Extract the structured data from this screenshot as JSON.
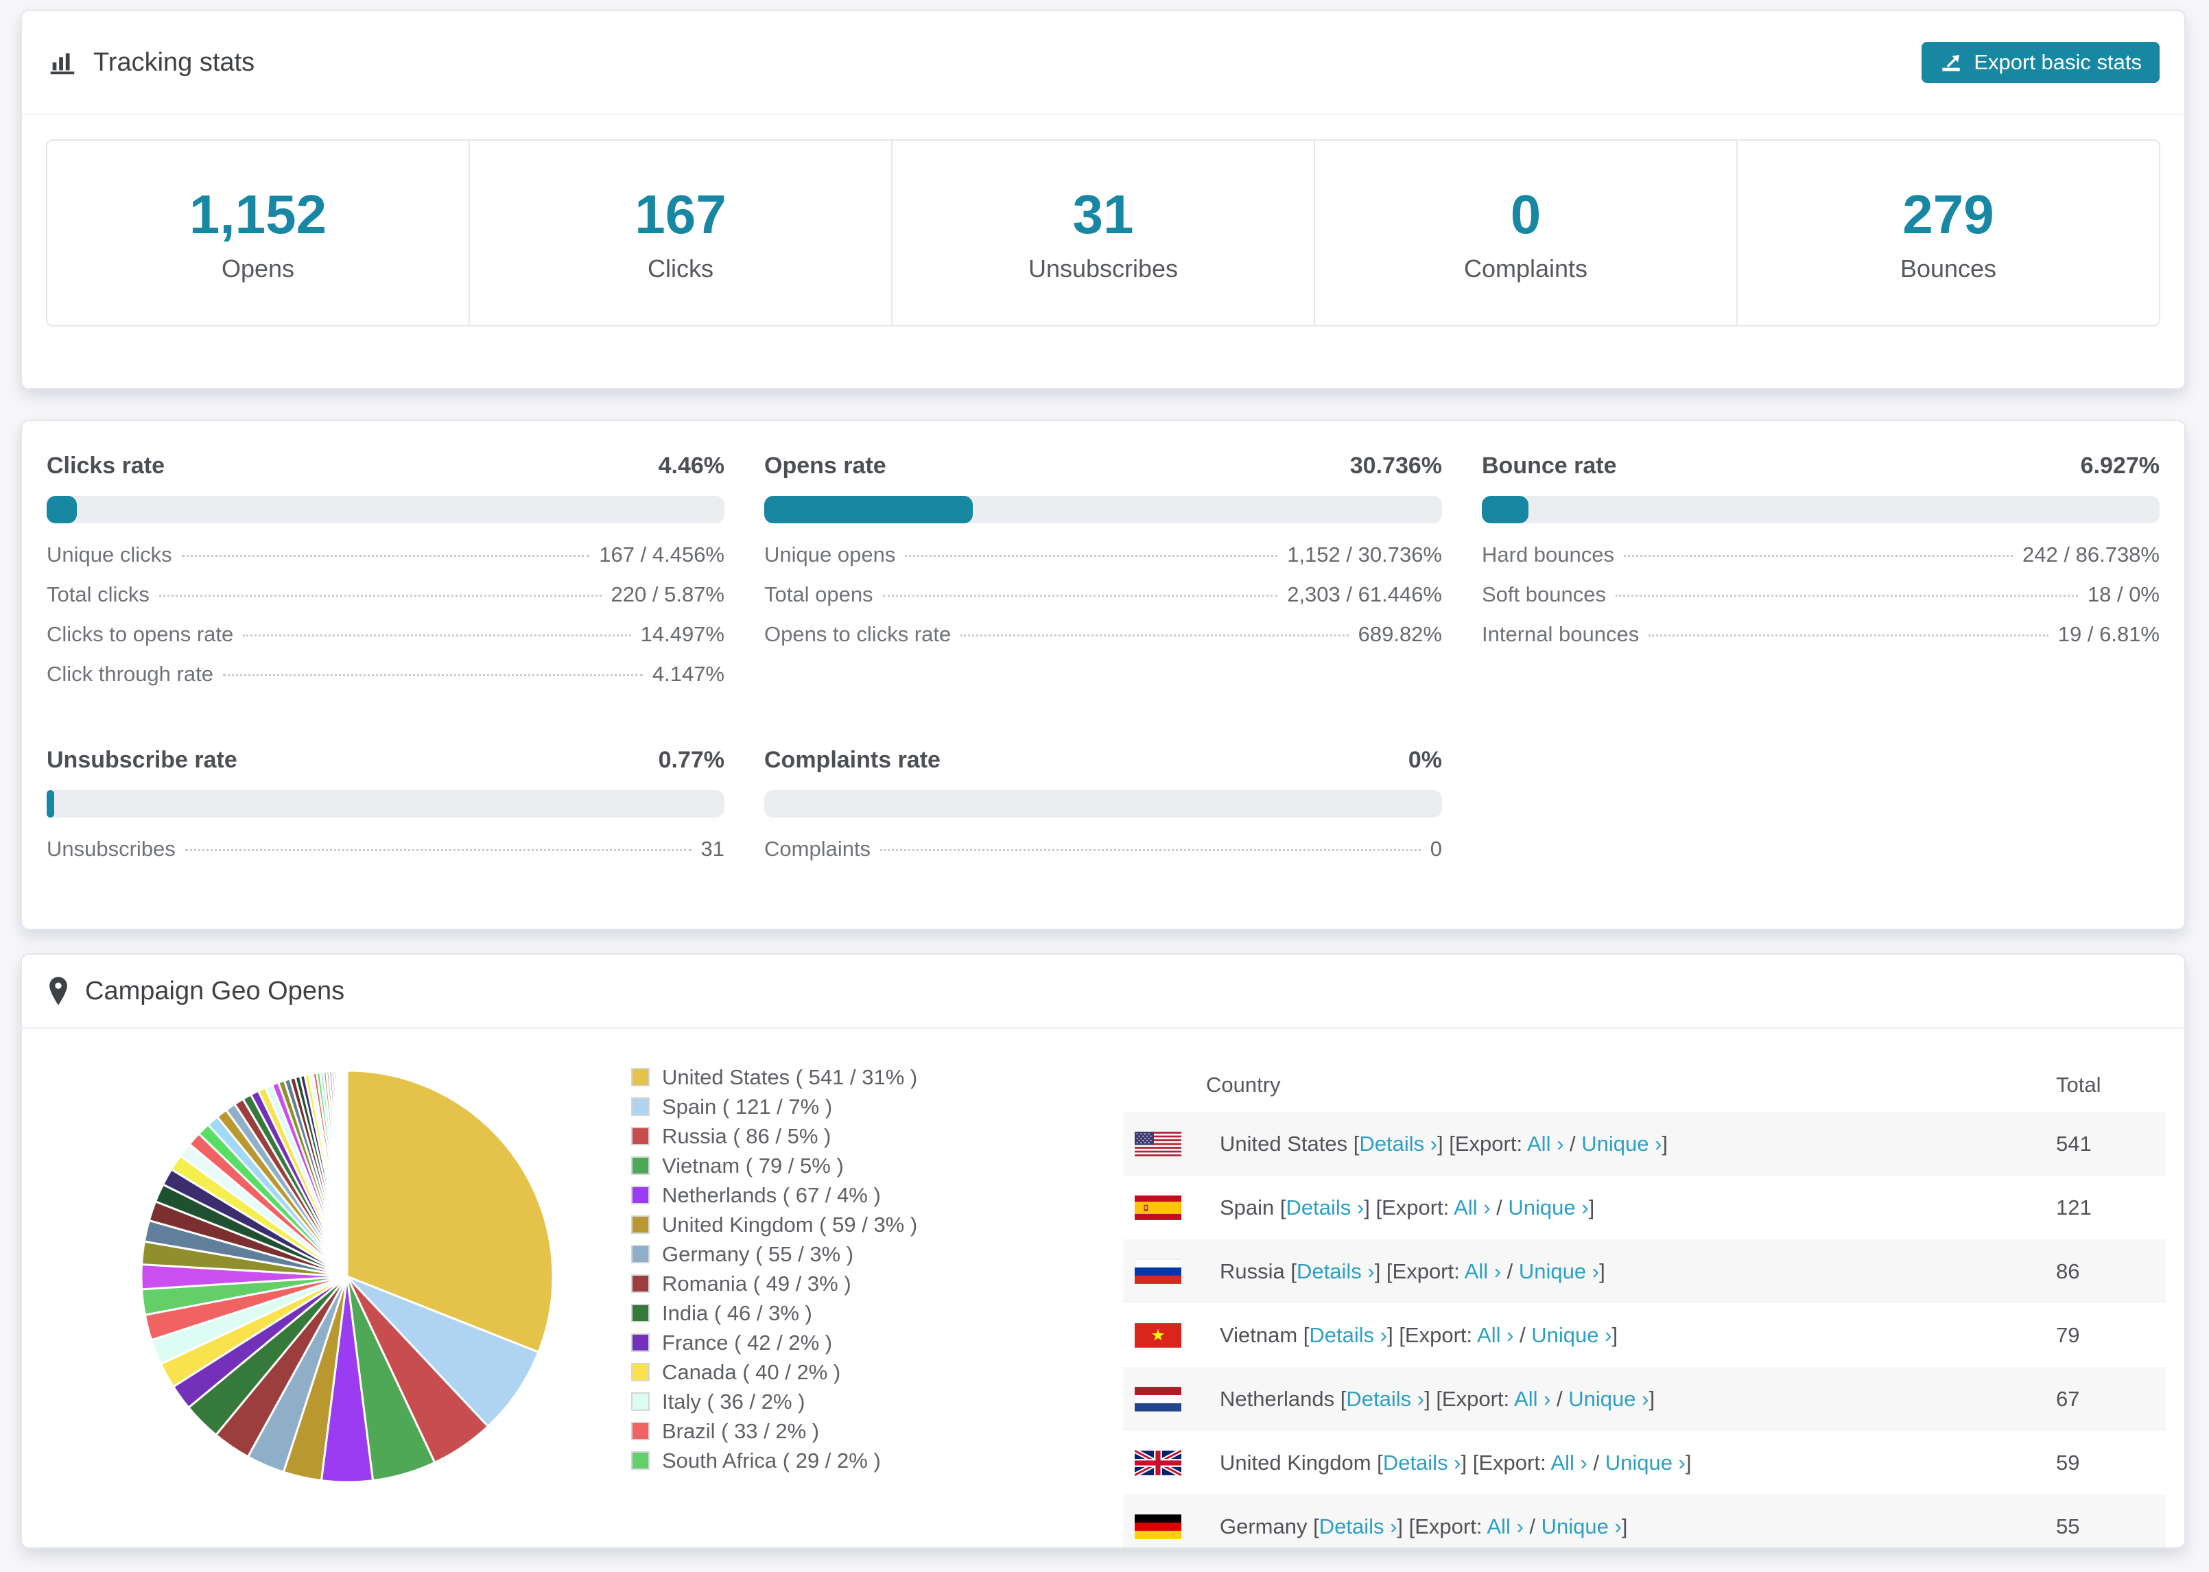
{
  "accent_color": "#1787a2",
  "link_color": "#2d9fc2",
  "tracking": {
    "title": "Tracking stats",
    "export_button": "Export basic stats",
    "stats": [
      {
        "value": "1,152",
        "label": "Opens"
      },
      {
        "value": "167",
        "label": "Clicks"
      },
      {
        "value": "31",
        "label": "Unsubscribes"
      },
      {
        "value": "0",
        "label": "Complaints"
      },
      {
        "value": "279",
        "label": "Bounces"
      }
    ]
  },
  "rates": [
    {
      "title": "Clicks rate",
      "value": "4.46%",
      "percent": 4.46,
      "rows": [
        {
          "label": "Unique clicks",
          "value": "167 / 4.456%"
        },
        {
          "label": "Total clicks",
          "value": "220 / 5.87%"
        },
        {
          "label": "Clicks to opens rate",
          "value": "14.497%"
        },
        {
          "label": "Click through rate",
          "value": "4.147%"
        }
      ]
    },
    {
      "title": "Opens rate",
      "value": "30.736%",
      "percent": 30.736,
      "rows": [
        {
          "label": "Unique opens",
          "value": "1,152 / 30.736%"
        },
        {
          "label": "Total opens",
          "value": "2,303 / 61.446%"
        },
        {
          "label": "Opens to clicks rate",
          "value": "689.82%"
        }
      ]
    },
    {
      "title": "Bounce rate",
      "value": "6.927%",
      "percent": 6.927,
      "rows": [
        {
          "label": "Hard bounces",
          "value": "242 / 86.738%"
        },
        {
          "label": "Soft bounces",
          "value": "18 / 0%"
        },
        {
          "label": "Internal bounces",
          "value": "19 / 6.81%"
        }
      ]
    },
    {
      "title": "Unsubscribe rate",
      "value": "0.77%",
      "percent": 0.77,
      "rows": [
        {
          "label": "Unsubscribes",
          "value": "31"
        }
      ]
    },
    {
      "title": "Complaints rate",
      "value": "0%",
      "percent": 0,
      "rows": [
        {
          "label": "Complaints",
          "value": "0"
        }
      ]
    }
  ],
  "geo": {
    "title": "Campaign Geo Opens",
    "table": {
      "headers": [
        "Country",
        "Total"
      ],
      "labels": {
        "details": "Details ›",
        "export_prefix": "[Export:",
        "all": "All ›",
        "unique": "Unique ›"
      },
      "rows": [
        {
          "country": "United States",
          "flag": "us",
          "total": "541"
        },
        {
          "country": "Spain",
          "flag": "es",
          "total": "121"
        },
        {
          "country": "Russia",
          "flag": "ru",
          "total": "86"
        },
        {
          "country": "Vietnam",
          "flag": "vn",
          "total": "79"
        },
        {
          "country": "Netherlands",
          "flag": "nl",
          "total": "67"
        },
        {
          "country": "United Kingdom",
          "flag": "gb",
          "total": "59"
        },
        {
          "country": "Germany",
          "flag": "de",
          "total": "55"
        }
      ]
    }
  },
  "chart_data": {
    "type": "pie",
    "title": "Campaign Geo Opens",
    "unit": "opens",
    "legend_position": "right",
    "labels": [
      "United States",
      "Spain",
      "Russia",
      "Vietnam",
      "Netherlands",
      "United Kingdom",
      "Germany",
      "Romania",
      "India",
      "France",
      "Canada",
      "Italy",
      "Brazil",
      "South Africa"
    ],
    "values": [
      541,
      121,
      86,
      79,
      67,
      59,
      55,
      49,
      46,
      42,
      40,
      36,
      33,
      29
    ],
    "percents": [
      31,
      7,
      5,
      5,
      4,
      3,
      3,
      3,
      3,
      2,
      2,
      2,
      2,
      2
    ],
    "colors": [
      "#e5c24a",
      "#aed4f2",
      "#c84d4f",
      "#4ea855",
      "#9b3bf2",
      "#b9992f",
      "#8fafc8",
      "#9d3e3e",
      "#35793b",
      "#7231b8",
      "#f8e24d",
      "#dcfcf4",
      "#f16263",
      "#62cf69"
    ],
    "others_percents": [
      1.9,
      1.767,
      1.643,
      1.528,
      1.421,
      1.322,
      1.229,
      1.143,
      1.063,
      0.989,
      0.92,
      0.855,
      0.795,
      0.74,
      0.688,
      0.64,
      0.595,
      0.553,
      0.515,
      0.479,
      0.445,
      0.414,
      0.385,
      0.358,
      0.333,
      0.31,
      0.288,
      0.268,
      0.249,
      0.232,
      0.215,
      0.2,
      0.186,
      0.173,
      0.161,
      0.15,
      0.139,
      0.13,
      0.121,
      0.112
    ],
    "others_colors": [
      "#cb4ff0",
      "#8f8f2d",
      "#5f7f9b",
      "#7c2f2f",
      "#1f5130",
      "#3b2d6e",
      "#f4ef4f",
      "#e8fbf8",
      "#f16263",
      "#57de63",
      "#a1d8f5",
      "#b9992f",
      "#8fafc8",
      "#9d3e3e",
      "#35793b",
      "#7231b8",
      "#f8e24d",
      "#dcfcf4"
    ]
  }
}
